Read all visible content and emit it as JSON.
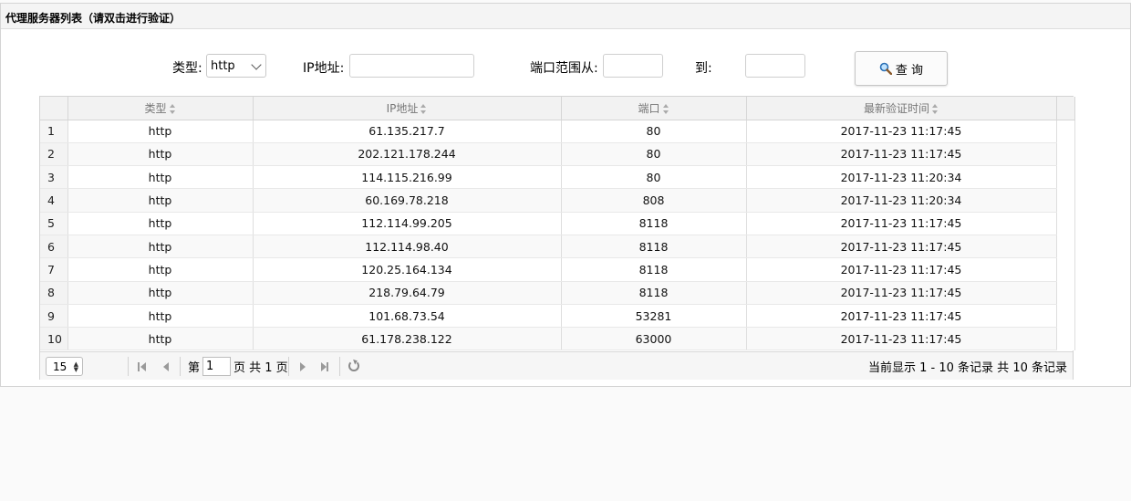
{
  "panel": {
    "title": "代理服务器列表（请双击进行验证）"
  },
  "search": {
    "type_label": "类型:",
    "type_value": "http",
    "ip_label": "IP地址:",
    "ip_value": "",
    "port_from_label": "端口范围从:",
    "port_from_value": "",
    "port_to_label": "到:",
    "port_to_value": "",
    "query_button": "查 询",
    "query_icon": "magnifier-icon"
  },
  "table": {
    "columns": [
      "类型",
      "IP地址",
      "端口",
      "最新验证时间"
    ],
    "rows": [
      {
        "n": "1",
        "type": "http",
        "ip": "61.135.217.7",
        "port": "80",
        "time": "2017-11-23 11:17:45"
      },
      {
        "n": "2",
        "type": "http",
        "ip": "202.121.178.244",
        "port": "80",
        "time": "2017-11-23 11:17:45"
      },
      {
        "n": "3",
        "type": "http",
        "ip": "114.115.216.99",
        "port": "80",
        "time": "2017-11-23 11:20:34"
      },
      {
        "n": "4",
        "type": "http",
        "ip": "60.169.78.218",
        "port": "808",
        "time": "2017-11-23 11:20:34"
      },
      {
        "n": "5",
        "type": "http",
        "ip": "112.114.99.205",
        "port": "8118",
        "time": "2017-11-23 11:17:45"
      },
      {
        "n": "6",
        "type": "http",
        "ip": "112.114.98.40",
        "port": "8118",
        "time": "2017-11-23 11:17:45"
      },
      {
        "n": "7",
        "type": "http",
        "ip": "120.25.164.134",
        "port": "8118",
        "time": "2017-11-23 11:17:45"
      },
      {
        "n": "8",
        "type": "http",
        "ip": "218.79.64.79",
        "port": "8118",
        "time": "2017-11-23 11:17:45"
      },
      {
        "n": "9",
        "type": "http",
        "ip": "101.68.73.54",
        "port": "53281",
        "time": "2017-11-23 11:17:45"
      },
      {
        "n": "10",
        "type": "http",
        "ip": "61.178.238.122",
        "port": "63000",
        "time": "2017-11-23 11:17:45"
      }
    ]
  },
  "pager": {
    "page_size": "15",
    "page_prefix": "第",
    "current_page": "1",
    "page_suffix": "页 共 1 页",
    "summary": "当前显示 1 - 10 条记录 共 10 条记录"
  }
}
